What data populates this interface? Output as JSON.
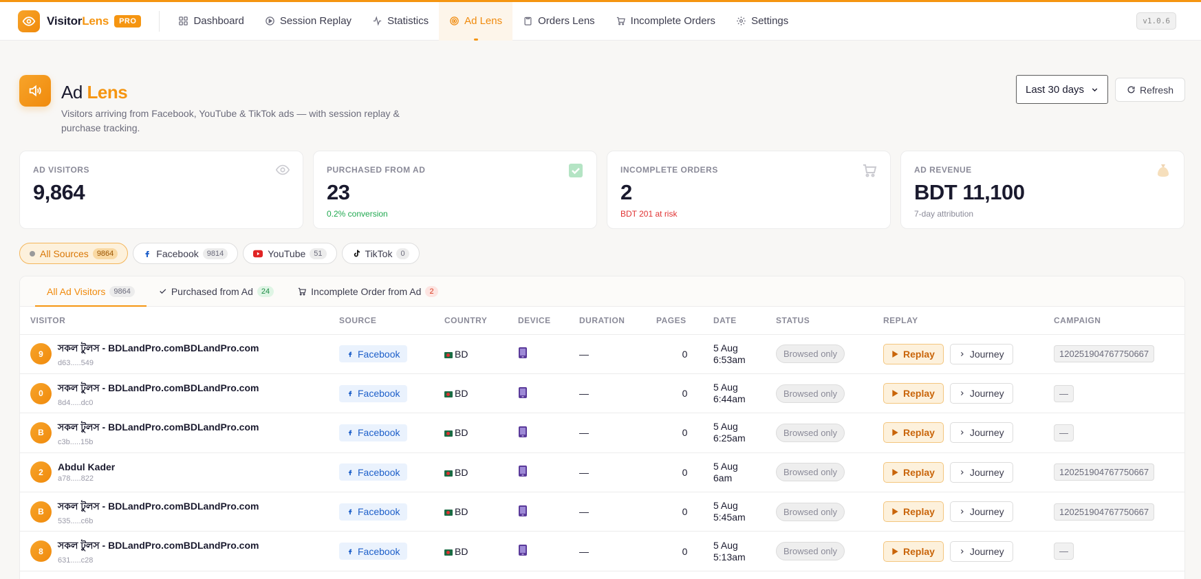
{
  "brand": {
    "name_main": "Visitor",
    "name_accent": "Lens",
    "badge": "PRO"
  },
  "nav": {
    "items": [
      {
        "label": "Dashboard",
        "icon": "grid-icon"
      },
      {
        "label": "Session Replay",
        "icon": "play-circle-icon"
      },
      {
        "label": "Statistics",
        "icon": "activity-icon"
      },
      {
        "label": "Ad Lens",
        "icon": "target-icon",
        "active": true
      },
      {
        "label": "Orders Lens",
        "icon": "clipboard-icon"
      },
      {
        "label": "Incomplete Orders",
        "icon": "cart-icon"
      },
      {
        "label": "Settings",
        "icon": "gear-icon"
      }
    ],
    "version": "v1.0.6"
  },
  "header": {
    "title_main": "Ad",
    "title_accent": "Lens",
    "subtitle": "Visitors arriving from Facebook, YouTube & TikTok ads — with session replay & purchase tracking.",
    "range": "Last 30 days",
    "refresh_label": "Refresh"
  },
  "stats": [
    {
      "label": "AD VISITORS",
      "value": "9,864",
      "sub": "",
      "icon": "eye-icon"
    },
    {
      "label": "PURCHASED FROM AD",
      "value": "23",
      "sub": "0.2% conversion",
      "icon": "check-square-icon"
    },
    {
      "label": "INCOMPLETE ORDERS",
      "value": "2",
      "sub": "BDT 201 at risk",
      "icon": "cart-icon"
    },
    {
      "label": "AD REVENUE",
      "value": "BDT 11,100",
      "sub": "7-day attribution",
      "icon": "money-bag-icon"
    }
  ],
  "sources": [
    {
      "label": "All Sources",
      "count": "9864"
    },
    {
      "label": "Facebook",
      "count": "9814"
    },
    {
      "label": "YouTube",
      "count": "51"
    },
    {
      "label": "TikTok",
      "count": "0"
    }
  ],
  "tabs": [
    {
      "label": "All Ad Visitors",
      "count": "9864"
    },
    {
      "label": "Purchased from Ad",
      "count": "24"
    },
    {
      "label": "Incomplete Order from Ad",
      "count": "2"
    }
  ],
  "columns": {
    "visitor": "VISITOR",
    "source": "SOURCE",
    "country": "COUNTRY",
    "device": "DEVICE",
    "duration": "DURATION",
    "pages": "PAGES",
    "date": "DATE",
    "status": "STATUS",
    "replay": "REPLAY",
    "campaign": "CAMPAIGN"
  },
  "actions": {
    "replay": "Replay",
    "journey": "Journey"
  },
  "rows": [
    {
      "initial": "9",
      "name": "সকল টুলস - BDLandPro.comBDLandPro.com",
      "id": "d63.....549",
      "source": "Facebook",
      "country": "BD",
      "duration": "—",
      "pages": "0",
      "date_day": "5 Aug",
      "date_time": "6:53am",
      "status": "Browsed only",
      "campaign": "120251904767750667"
    },
    {
      "initial": "0",
      "name": "সকল টুলস - BDLandPro.comBDLandPro.com",
      "id": "8d4.....dc0",
      "source": "Facebook",
      "country": "BD",
      "duration": "—",
      "pages": "0",
      "date_day": "5 Aug",
      "date_time": "6:44am",
      "status": "Browsed only",
      "campaign": "—"
    },
    {
      "initial": "B",
      "name": "সকল টুলস - BDLandPro.comBDLandPro.com",
      "id": "c3b.....15b",
      "source": "Facebook",
      "country": "BD",
      "duration": "—",
      "pages": "0",
      "date_day": "5 Aug",
      "date_time": "6:25am",
      "status": "Browsed only",
      "campaign": "—"
    },
    {
      "initial": "2",
      "name": "Abdul Kader",
      "id": "a78.....822",
      "source": "Facebook",
      "country": "BD",
      "duration": "—",
      "pages": "0",
      "date_day": "5 Aug",
      "date_time": "6am",
      "status": "Browsed only",
      "campaign": "120251904767750667"
    },
    {
      "initial": "B",
      "name": "সকল টুলস - BDLandPro.comBDLandPro.com",
      "id": "535.....c6b",
      "source": "Facebook",
      "country": "BD",
      "duration": "—",
      "pages": "0",
      "date_day": "5 Aug",
      "date_time": "5:45am",
      "status": "Browsed only",
      "campaign": "120251904767750667"
    },
    {
      "initial": "8",
      "name": "সকল টুলস - BDLandPro.comBDLandPro.com",
      "id": "631.....c28",
      "source": "Facebook",
      "country": "BD",
      "duration": "—",
      "pages": "0",
      "date_day": "5 Aug",
      "date_time": "5:13am",
      "status": "Browsed only",
      "campaign": "—"
    }
  ],
  "colors": {
    "accent": "#f59511",
    "facebook": "#1d5fc9",
    "youtube": "#e02424"
  }
}
